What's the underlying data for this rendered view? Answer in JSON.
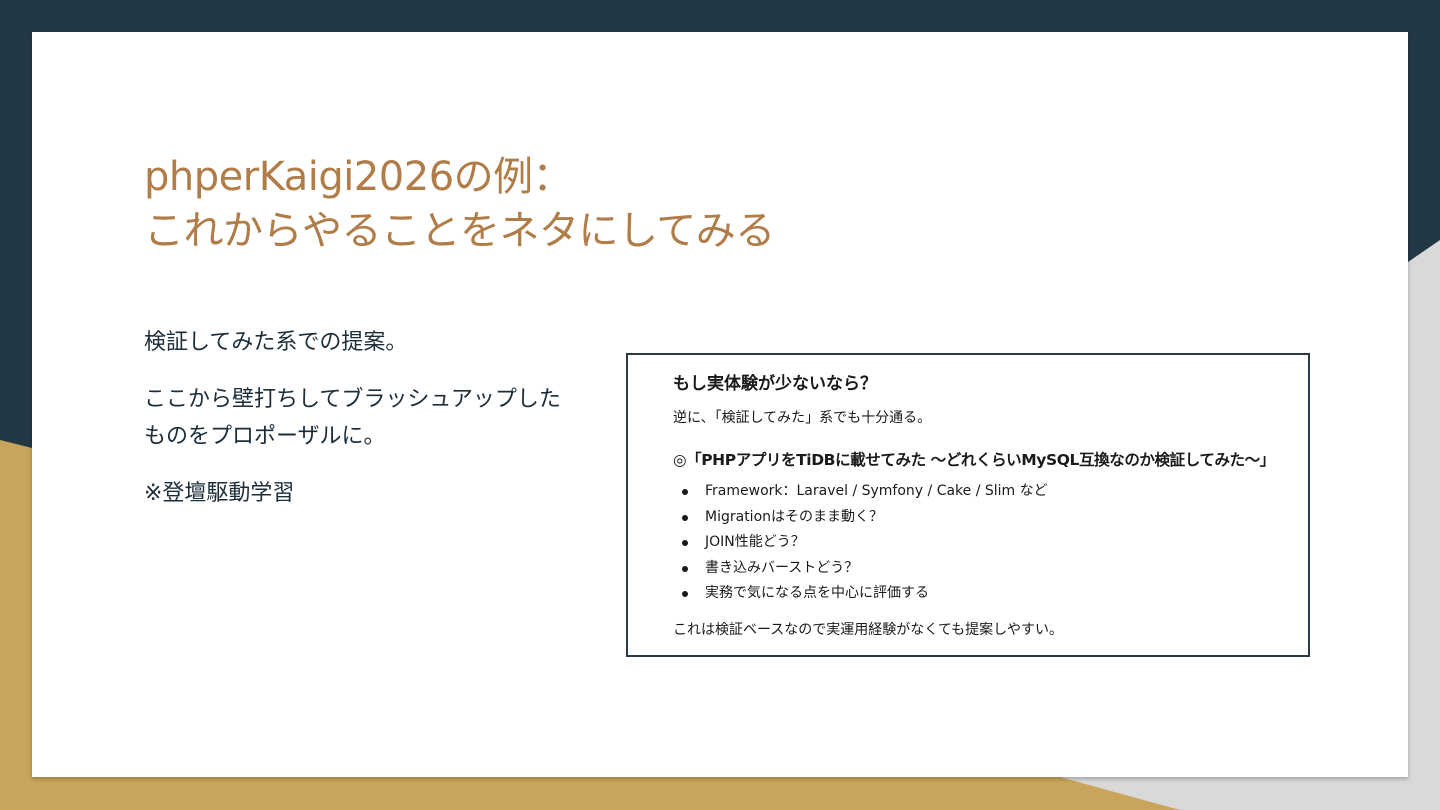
{
  "colors": {
    "background_dark": "#233845",
    "background_gold": "#c8a55a",
    "background_grey": "#d9d9d9",
    "title": "#b07c48",
    "body_text": "#1c2e3a"
  },
  "slide": {
    "title_line1": "phperKaigi2026の例：",
    "title_line2": "これからやることをネタにしてみる",
    "body": {
      "p1": "検証してみた系での提案。",
      "p2_line1": "ここから壁打ちしてブラッシュアップした",
      "p2_line2": "ものをプロポーザルに。",
      "p3": "※登壇駆動学習"
    },
    "screenshot": {
      "heading": "もし実体験が少ないなら？",
      "subtext": "逆に、「検証してみた」系でも十分通る。",
      "topic": "◎「PHPアプリをTiDBに載せてみた 〜どれくらいMySQL互換なのか検証してみた〜」",
      "items": [
        "Framework：Laravel / Symfony / Cake / Slim など",
        "Migrationはそのまま動く？",
        "JOIN性能どう？",
        "書き込みバーストどう？",
        "実務で気になる点を中心に評価する"
      ],
      "footer": "これは検証ベースなので実運用経験がなくても提案しやすい。"
    }
  }
}
